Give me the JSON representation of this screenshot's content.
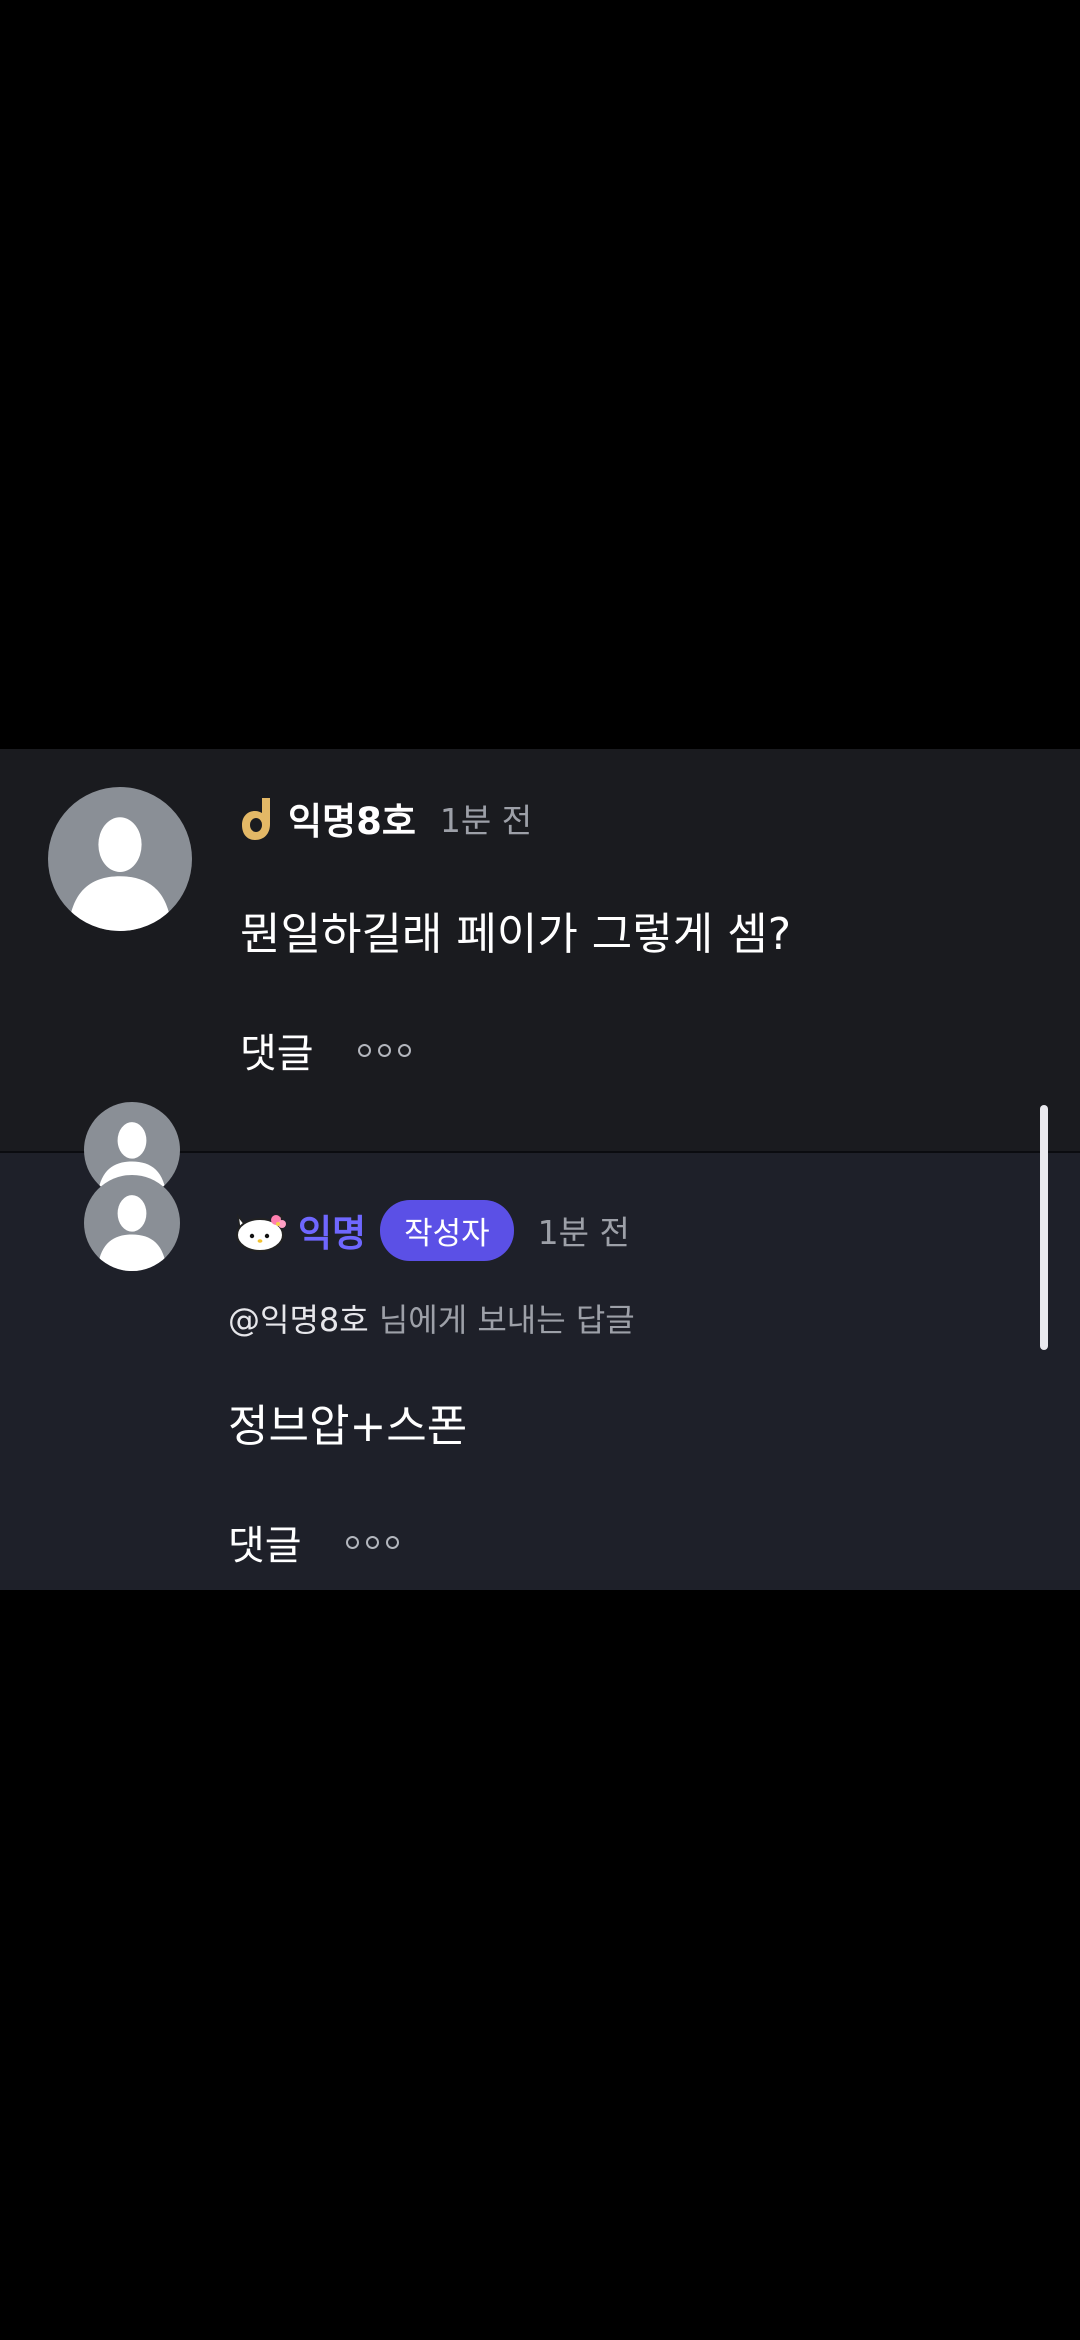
{
  "colors": {
    "background": "#000000",
    "comment_bg": "#1a1b1f",
    "reply_bg": "#1e2029",
    "accent_purple": "#6f67ff",
    "badge_bg": "#5b50e6",
    "muted_text": "#9da0a8"
  },
  "comment": {
    "avatar_icon": "default-profile-silhouette-icon",
    "level_icon": "gold-d-level-icon",
    "username": "익명8호",
    "time": "1분 전",
    "body": "뭔일하길래 페이가 그렇게 셈?",
    "reply_label": "댓글",
    "more_icon": "more-dots-icon"
  },
  "reply": {
    "avatar_icon": "default-profile-silhouette-icon",
    "level_icon": "hello-kitty-level-icon",
    "username": "익명",
    "badge": "작성자",
    "time": "1분 전",
    "mention": "@익명8호",
    "mention_suffix": " 님에게 보내는 답글",
    "body": "정브압+스폰",
    "reply_label": "댓글",
    "more_icon": "more-dots-icon"
  }
}
